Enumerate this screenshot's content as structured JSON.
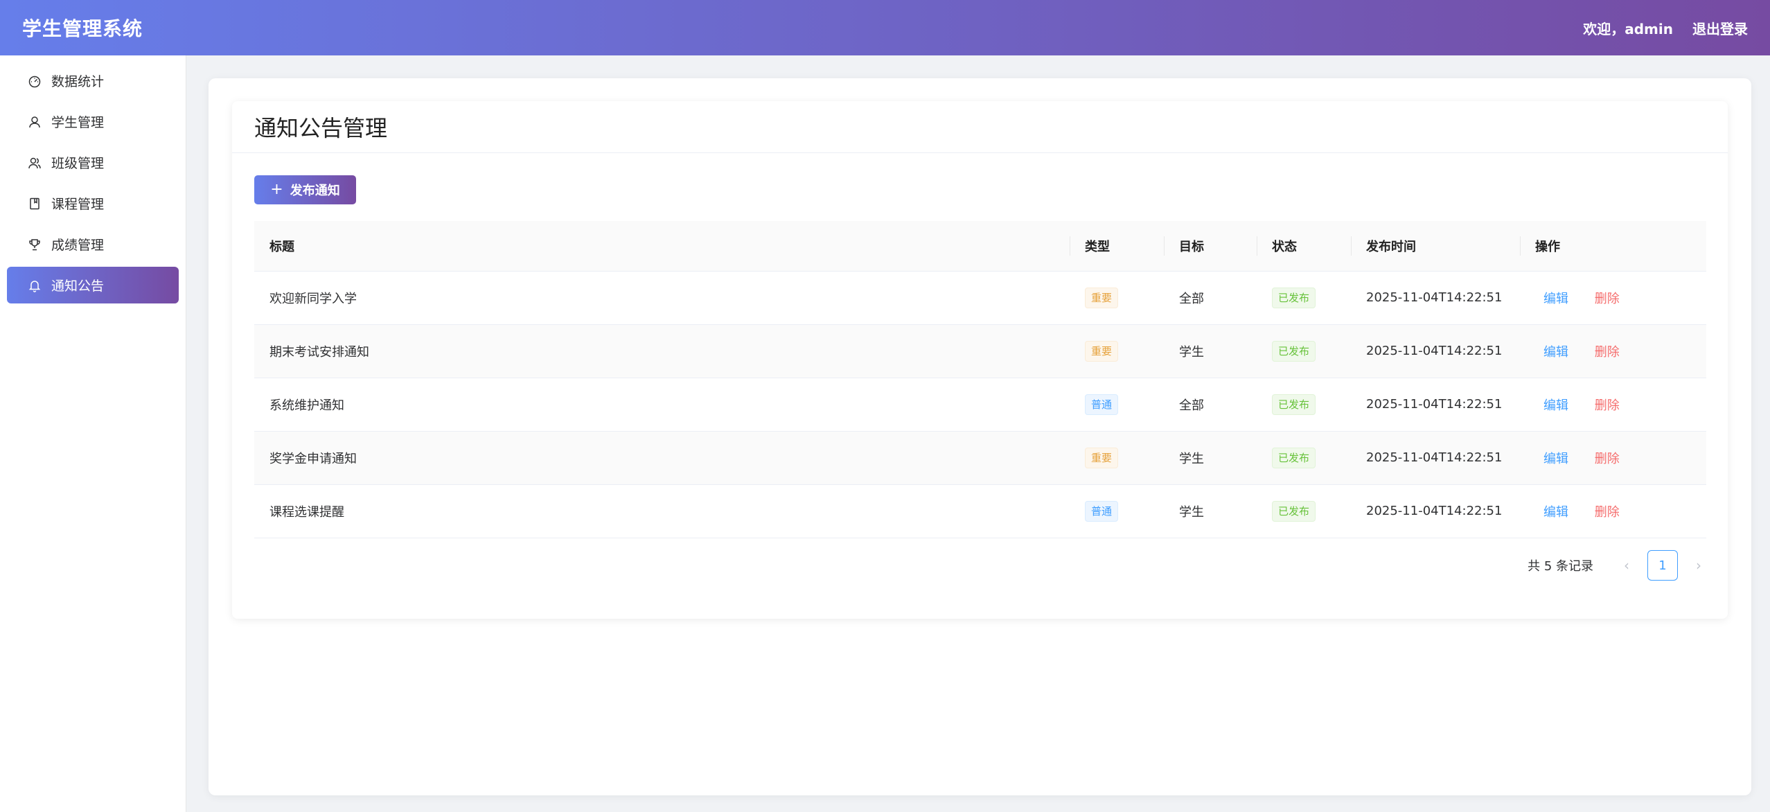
{
  "header": {
    "app_title": "学生管理系统",
    "welcome": "欢迎，admin",
    "logout": "退出登录"
  },
  "sidebar": {
    "items": [
      {
        "label": "数据统计",
        "icon": "dashboard-icon"
      },
      {
        "label": "学生管理",
        "icon": "user-icon"
      },
      {
        "label": "班级管理",
        "icon": "group-icon"
      },
      {
        "label": "课程管理",
        "icon": "book-icon"
      },
      {
        "label": "成绩管理",
        "icon": "trophy-icon"
      },
      {
        "label": "通知公告",
        "icon": "bell-icon",
        "active": true
      }
    ]
  },
  "page": {
    "title": "通知公告管理",
    "publish_button": "发布通知"
  },
  "table": {
    "headers": {
      "title": "标题",
      "type": "类型",
      "target": "目标",
      "status": "状态",
      "time": "发布时间",
      "ops": "操作"
    },
    "rows": [
      {
        "title": "欢迎新同学入学",
        "type": "重要",
        "target": "全部",
        "status": "已发布",
        "time": "2025-11-04T14:22:51",
        "edit": "编辑",
        "delete": "删除"
      },
      {
        "title": "期末考试安排通知",
        "type": "重要",
        "target": "学生",
        "status": "已发布",
        "time": "2025-11-04T14:22:51",
        "edit": "编辑",
        "delete": "删除"
      },
      {
        "title": "系统维护通知",
        "type": "普通",
        "target": "全部",
        "status": "已发布",
        "time": "2025-11-04T14:22:51",
        "edit": "编辑",
        "delete": "删除"
      },
      {
        "title": "奖学金申请通知",
        "type": "重要",
        "target": "学生",
        "status": "已发布",
        "time": "2025-11-04T14:22:51",
        "edit": "编辑",
        "delete": "删除"
      },
      {
        "title": "课程选课提醒",
        "type": "普通",
        "target": "学生",
        "status": "已发布",
        "time": "2025-11-04T14:22:51",
        "edit": "编辑",
        "delete": "删除"
      }
    ]
  },
  "pagination": {
    "total": "共 5 条记录",
    "current": "1"
  },
  "colors": {
    "gradient_start": "#667eea",
    "gradient_end": "#764ba2",
    "tag_important": "#e6a23c",
    "tag_normal": "#409eff",
    "tag_published": "#67c23a",
    "link_edit": "#409eff",
    "link_delete": "#f56c6c"
  }
}
